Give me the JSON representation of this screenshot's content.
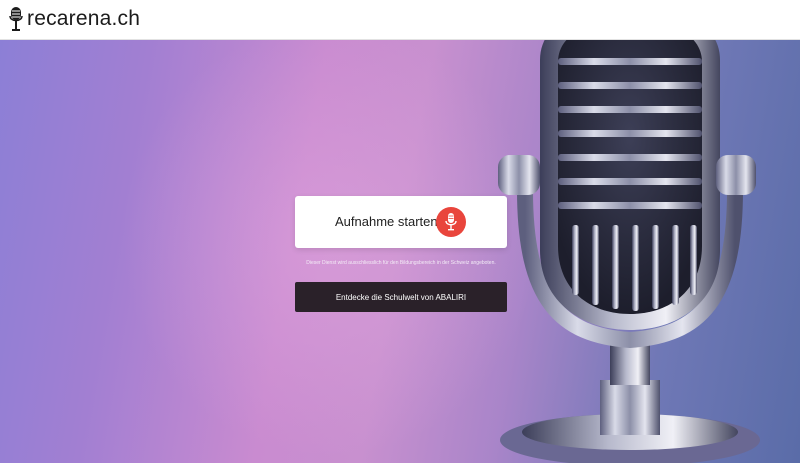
{
  "header": {
    "brand": "recarena.ch"
  },
  "main": {
    "record_label": "Aufnahme starten",
    "notice": "Dieser Dienst wird ausschliesslich für den Bildungsbereich in der Schweiz angeboten.",
    "cta_label": "Entdecke die Schulwelt von ABALIRI"
  },
  "icons": {
    "brand": "microphone-icon",
    "record": "microphone-icon"
  },
  "colors": {
    "record_button": "#e9453c",
    "cta_background": "#2a2129",
    "header_background": "#ffffff"
  }
}
